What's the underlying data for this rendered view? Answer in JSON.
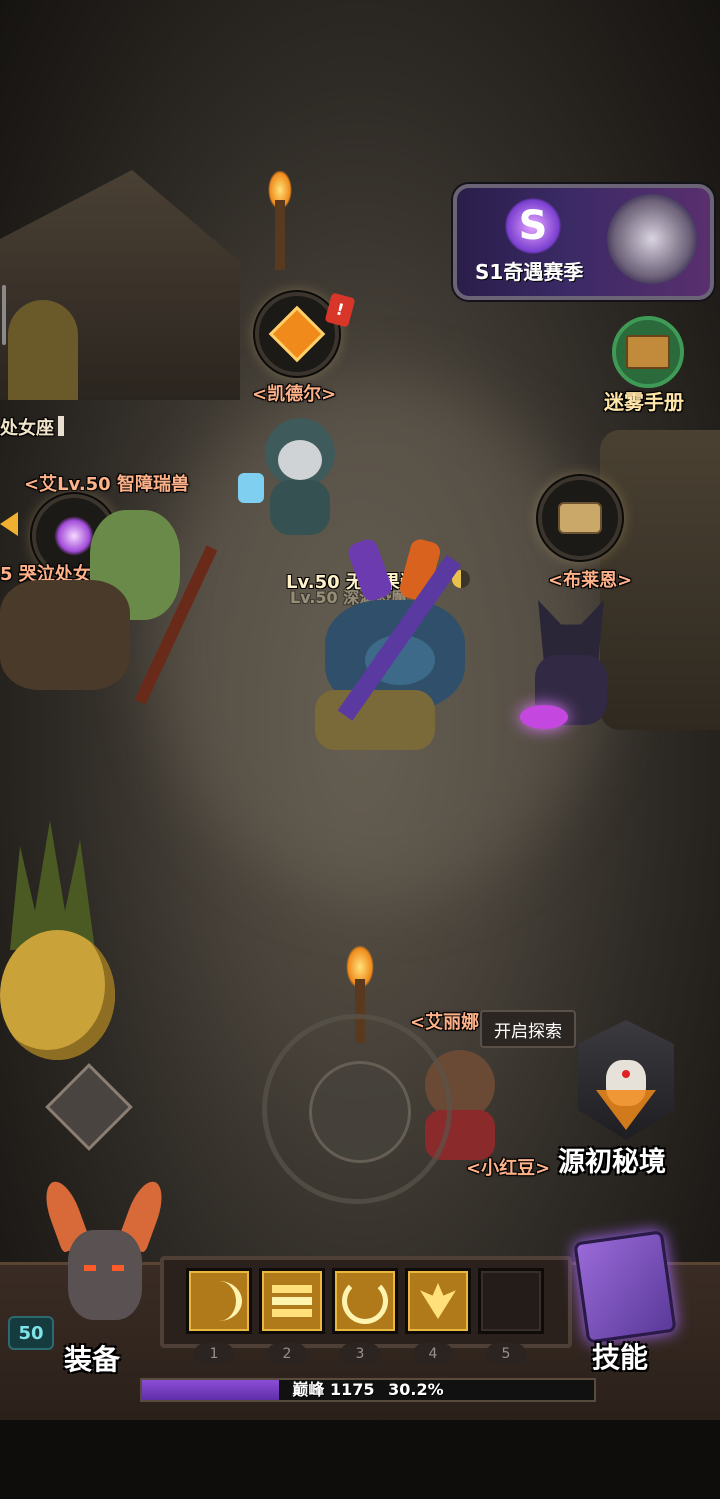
{
  "season_banner": {
    "label": "S1奇遇赛季",
    "glyph": "S"
  },
  "fog_manual": {
    "label": "迷雾手册"
  },
  "npcs": {
    "kaideer": {
      "label": "<凯德尔>"
    },
    "bulaien": {
      "label": "<布莱恩>"
    },
    "ailina": {
      "label": "<艾丽娜"
    },
    "xiaohongdou": {
      "label": "<小红豆>"
    }
  },
  "player": {
    "name": "Lv.50 无畏果酱鸡",
    "title": "Lv.50 深渊恐魔"
  },
  "other_players": {
    "left_top": {
      "label": "处女座"
    },
    "left_mid": {
      "name": "<艾Lv.50 智障瑞兽",
      "sub": "5 哭泣处女座"
    }
  },
  "explore_tooltip": "开启探索",
  "origin_realm": {
    "label": "源初秘境"
  },
  "equipment": {
    "label": "装备",
    "level": "50"
  },
  "skills": {
    "label": "技能",
    "slot_numbers": [
      "1",
      "2",
      "3",
      "4",
      "5"
    ]
  },
  "peak": {
    "label": "巅峰",
    "value": "1175",
    "percent_text": "30.2%",
    "progress": 0.302
  },
  "colors": {
    "npc_label": "#ffb28a",
    "xp_bar": "#8c4dd6",
    "banner_bg": "#3b2a66"
  }
}
